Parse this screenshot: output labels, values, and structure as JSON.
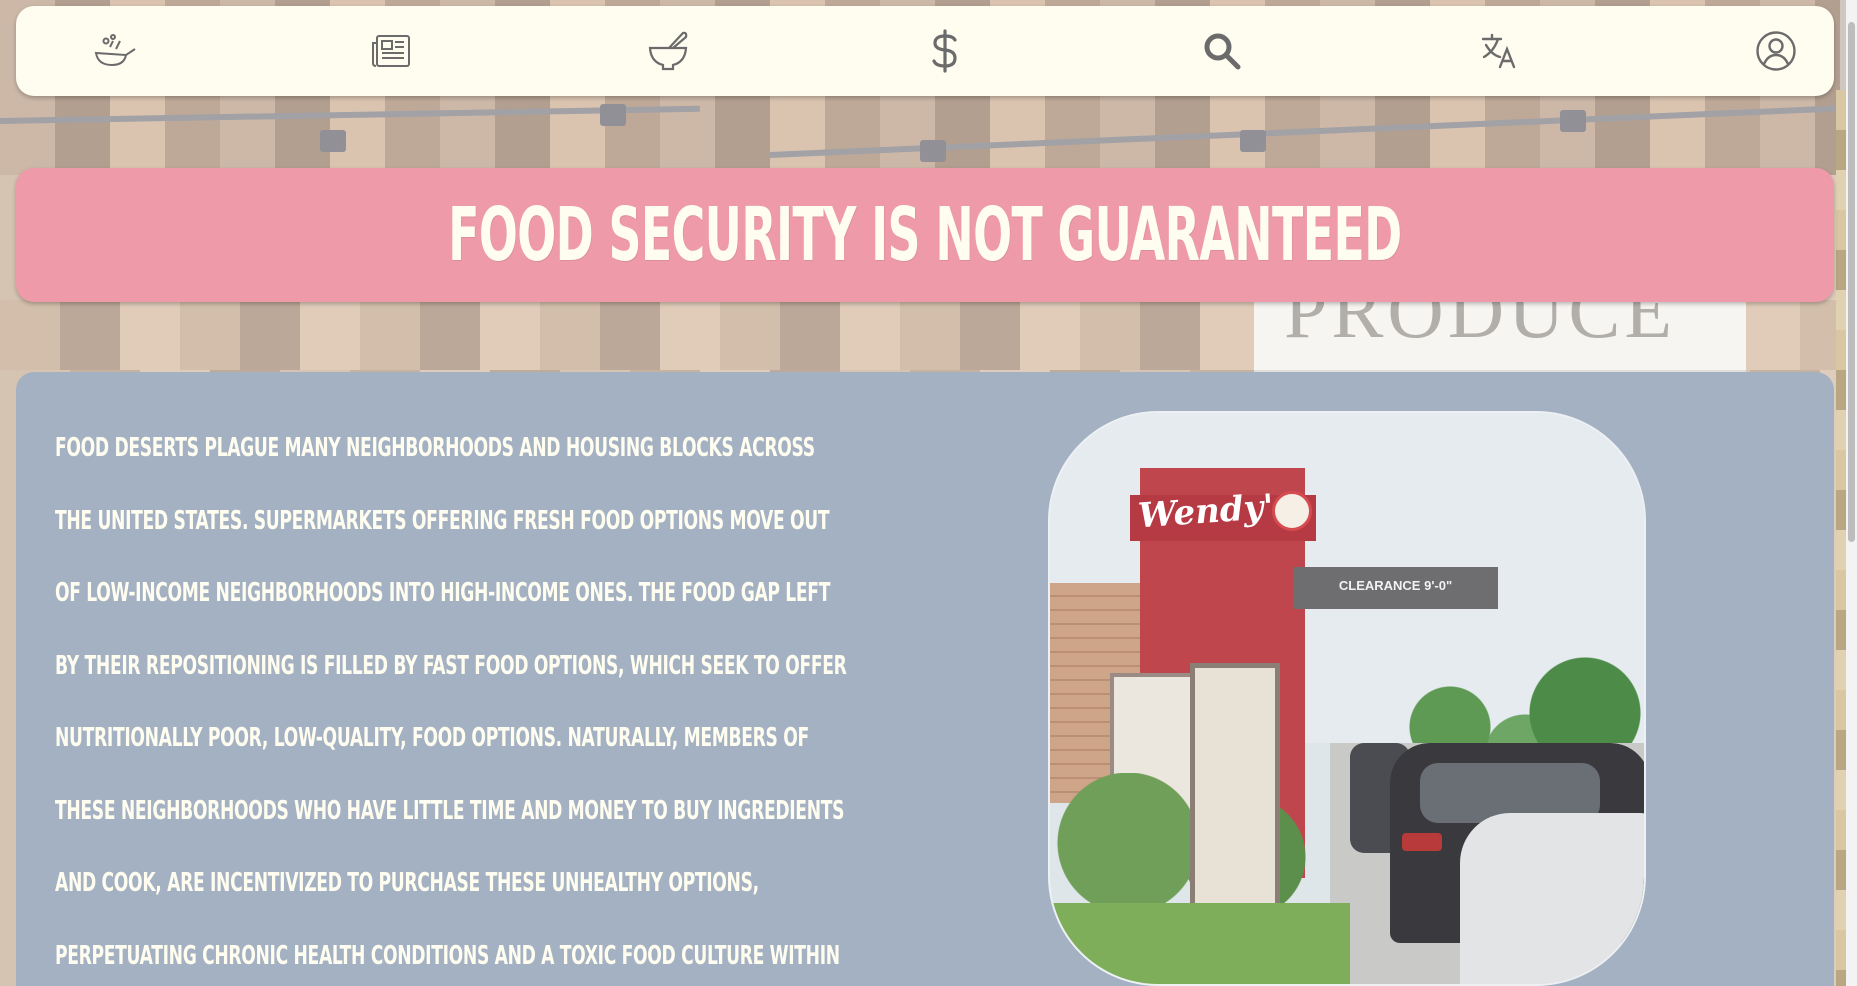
{
  "nav": {
    "items": [
      {
        "name": "cooking-pan-icon",
        "label": "Cooking"
      },
      {
        "name": "newspaper-icon",
        "label": "News"
      },
      {
        "name": "mortar-pestle-icon",
        "label": "Recipes"
      },
      {
        "name": "dollar-icon",
        "label": "Donate"
      },
      {
        "name": "search-icon",
        "label": "Search"
      },
      {
        "name": "translate-icon",
        "label": "Language"
      },
      {
        "name": "account-icon",
        "label": "Account"
      }
    ]
  },
  "background": {
    "sign_text": "PRODUCE"
  },
  "banner": {
    "title": "FOOD SECURITY IS NOT GUARANTEED",
    "color": "#ee9aa9"
  },
  "content": {
    "panel_color": "#a3b1c2",
    "paragraph_lines": [
      "Food deserts plague many neighborhoods and housing blocks across",
      "the United States. Supermarkets offering fresh food options move out",
      "of low-income neighborhoods into high-income ones. The food gap left",
      "by their repositioning is filled by fast food options, which seek to offer",
      "nutritionally poor, low-quality, food options. Naturally, members of",
      "these neighborhoods who have little time and money to buy ingredients",
      "and cook, are incentivized to purchase these unhealthy options,",
      "perpetuating chronic health conditions and a toxic food culture within"
    ],
    "photo": {
      "brand_text": "Wendy's",
      "canopy_text": "CLEARANCE 9'-0\""
    }
  }
}
